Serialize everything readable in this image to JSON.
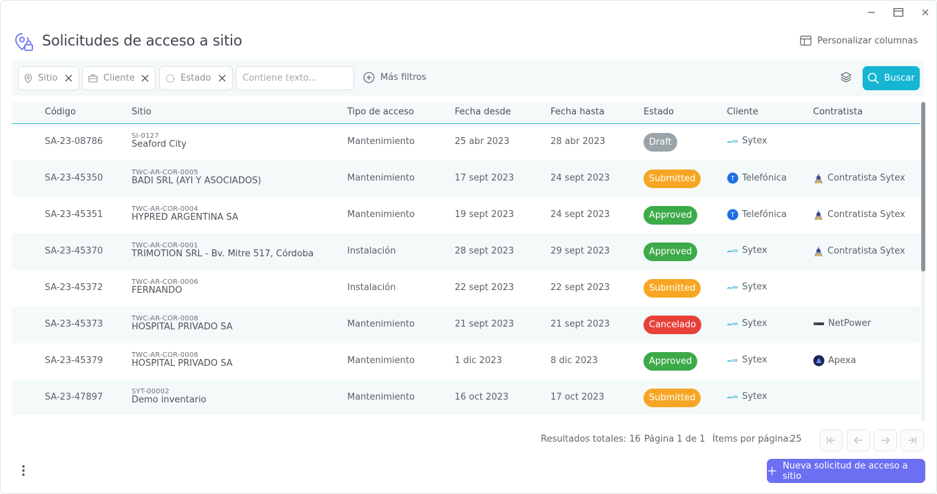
{
  "page": {
    "title": "Solicitudes de acceso a sitio",
    "customize_label": "Personalizar columnas"
  },
  "filters": {
    "chips": [
      {
        "label": "Sitio",
        "icon": "location-pin-icon"
      },
      {
        "label": "Cliente",
        "icon": "briefcase-icon"
      },
      {
        "label": "Estado",
        "icon": "dashed-circle-icon"
      }
    ],
    "text_placeholder": "Contiene texto...",
    "more_label": "Más filtros",
    "search_label": "Buscar"
  },
  "table": {
    "columns": [
      "Código",
      "Sitio",
      "Tipo de acceso",
      "Fecha desde",
      "Fecha hasta",
      "Estado",
      "Cliente",
      "Contratista"
    ],
    "rows": [
      {
        "codigo": "SA-23-08786",
        "site_code": "SI-0127",
        "site_name": "Seaford City",
        "tipo": "Mantenimiento",
        "desde": "25 abr 2023",
        "hasta": "28 abr 2023",
        "estado": "Draft",
        "cliente": "Sytex",
        "contratista": ""
      },
      {
        "codigo": "SA-23-45350",
        "site_code": "TWC-AR-COR-0005",
        "site_name": "BADI SRL (AYI Y ASOCIADOS)",
        "tipo": "Mantenimiento",
        "desde": "17 sept 2023",
        "hasta": "24 sept 2023",
        "estado": "Submitted",
        "cliente": "Telefónica",
        "contratista": "Contratista Sytex"
      },
      {
        "codigo": "SA-23-45351",
        "site_code": "TWC-AR-COR-0004",
        "site_name": "HYPRED ARGENTINA SA",
        "tipo": "Mantenimiento",
        "desde": "19 sept 2023",
        "hasta": "24 sept 2023",
        "estado": "Approved",
        "cliente": "Telefónica",
        "contratista": "Contratista Sytex"
      },
      {
        "codigo": "SA-23-45370",
        "site_code": "TWC-AR-COR-0001",
        "site_name": "TRIMOTION SRL - Bv. Mitre 517, Córdoba",
        "tipo": "Instalación",
        "desde": "28 sept 2023",
        "hasta": "29 sept 2023",
        "estado": "Approved",
        "cliente": "Sytex",
        "contratista": "Contratista Sytex"
      },
      {
        "codigo": "SA-23-45372",
        "site_code": "TWC-AR-COR-0006",
        "site_name": "FERNANDO",
        "tipo": "Instalación",
        "desde": "22 sept 2023",
        "hasta": "22 sept 2023",
        "estado": "Submitted",
        "cliente": "Sytex",
        "contratista": ""
      },
      {
        "codigo": "SA-23-45373",
        "site_code": "TWC-AR-COR-0008",
        "site_name": "HOSPITAL PRIVADO SA",
        "tipo": "Mantenimiento",
        "desde": "21 sept 2023",
        "hasta": "21 sept 2023",
        "estado": "Cancelado",
        "cliente": "Sytex",
        "contratista": "NetPower"
      },
      {
        "codigo": "SA-23-45379",
        "site_code": "TWC-AR-COR-0008",
        "site_name": "HOSPITAL PRIVADO SA",
        "tipo": "Mantenimiento",
        "desde": "1 dic 2023",
        "hasta": "8 dic 2023",
        "estado": "Approved",
        "cliente": "Sytex",
        "contratista": "Apexa"
      },
      {
        "codigo": "SA-23-47897",
        "site_code": "SYT-00002",
        "site_name": "Demo inventario",
        "tipo": "Mantenimiento",
        "desde": "16 oct 2023",
        "hasta": "17 oct 2023",
        "estado": "Submitted",
        "cliente": "Sytex",
        "contratista": ""
      }
    ]
  },
  "status_colors": {
    "Draft": "#9aa3a8",
    "Submitted": "#f7a623",
    "Approved": "#3daa4a",
    "Cancelado": "#e8413a"
  },
  "pagination": {
    "total_label": "Resultados totales: 16",
    "page_label": "Página 1 de 1",
    "per_page_label": "Ítems por página:",
    "per_page_value": "25"
  },
  "footer": {
    "new_button_label": "Nueva solicitud de acceso a sitio"
  },
  "colors": {
    "accent": "#16b5d3",
    "primary_button": "#6c6ff2"
  }
}
